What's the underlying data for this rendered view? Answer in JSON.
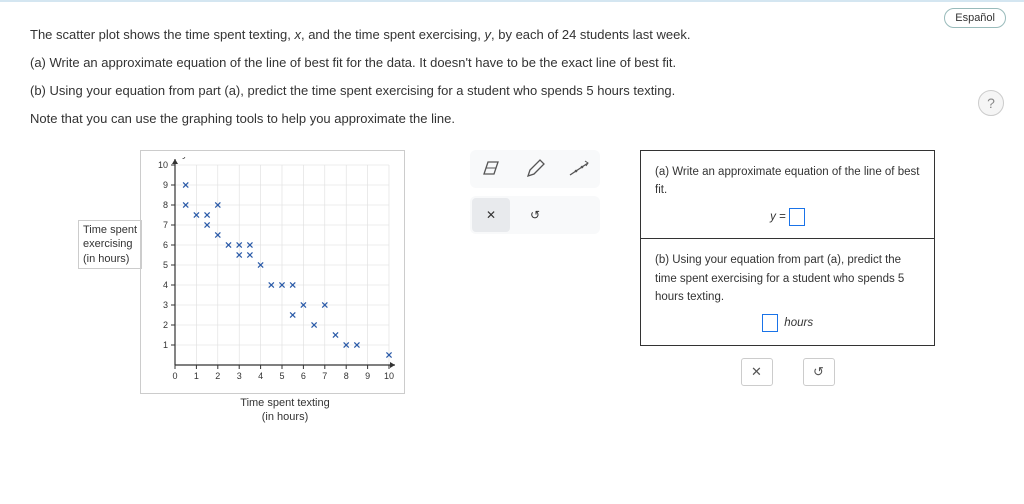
{
  "lang_button": "Español",
  "help": "?",
  "intro": {
    "line1_pre": "The scatter plot shows the time spent texting, ",
    "x": "x",
    "line1_mid": ", and the time spent exercising, ",
    "y": "y",
    "line1_post": ", by each of 24 students last week.",
    "a": "(a) Write an approximate equation of the line of best fit for the data. It doesn't have to be the exact line of best fit.",
    "b": "(b) Using your equation from part (a), predict the time spent exercising for a student who spends 5 hours texting.",
    "note": "Note that you can use the graphing tools to help you approximate the line."
  },
  "ylabel_l1": "Time spent",
  "ylabel_l2": "exercising",
  "ylabel_l3": "(in hours)",
  "xlabel_l1": "Time spent texting",
  "xlabel_l2": "(in hours)",
  "panel": {
    "a_label": "(a) Write an approximate equation of the line of best fit.",
    "y_eq": "y =",
    "b_label": "(b) Using your equation from part (a), predict the time spent exercising for a student who spends 5 hours texting.",
    "hours": "hours"
  },
  "actions": {
    "cancel": "✕",
    "reset": "↺"
  },
  "chart_data": {
    "type": "scatter",
    "xlabel": "Time spent texting (in hours)",
    "ylabel": "Time spent exercising (in hours)",
    "xlim": [
      0,
      10
    ],
    "ylim": [
      0,
      10
    ],
    "xticks": [
      0,
      1,
      2,
      3,
      4,
      5,
      6,
      7,
      8,
      9,
      10
    ],
    "yticks": [
      1,
      2,
      3,
      4,
      5,
      6,
      7,
      8,
      9,
      10
    ],
    "points": [
      [
        0.5,
        9
      ],
      [
        0.5,
        8
      ],
      [
        1,
        7.5
      ],
      [
        1.5,
        7
      ],
      [
        1.5,
        7.5
      ],
      [
        2,
        6.5
      ],
      [
        2,
        8
      ],
      [
        2.5,
        6
      ],
      [
        3,
        6
      ],
      [
        3,
        5.5
      ],
      [
        3.5,
        5.5
      ],
      [
        3.5,
        6
      ],
      [
        4,
        5
      ],
      [
        4.5,
        4
      ],
      [
        5,
        4
      ],
      [
        5.5,
        4
      ],
      [
        5.5,
        2.5
      ],
      [
        6,
        3
      ],
      [
        6.5,
        2
      ],
      [
        7,
        3
      ],
      [
        7.5,
        1.5
      ],
      [
        8,
        1
      ],
      [
        8.5,
        1
      ],
      [
        10,
        0.5
      ]
    ]
  }
}
